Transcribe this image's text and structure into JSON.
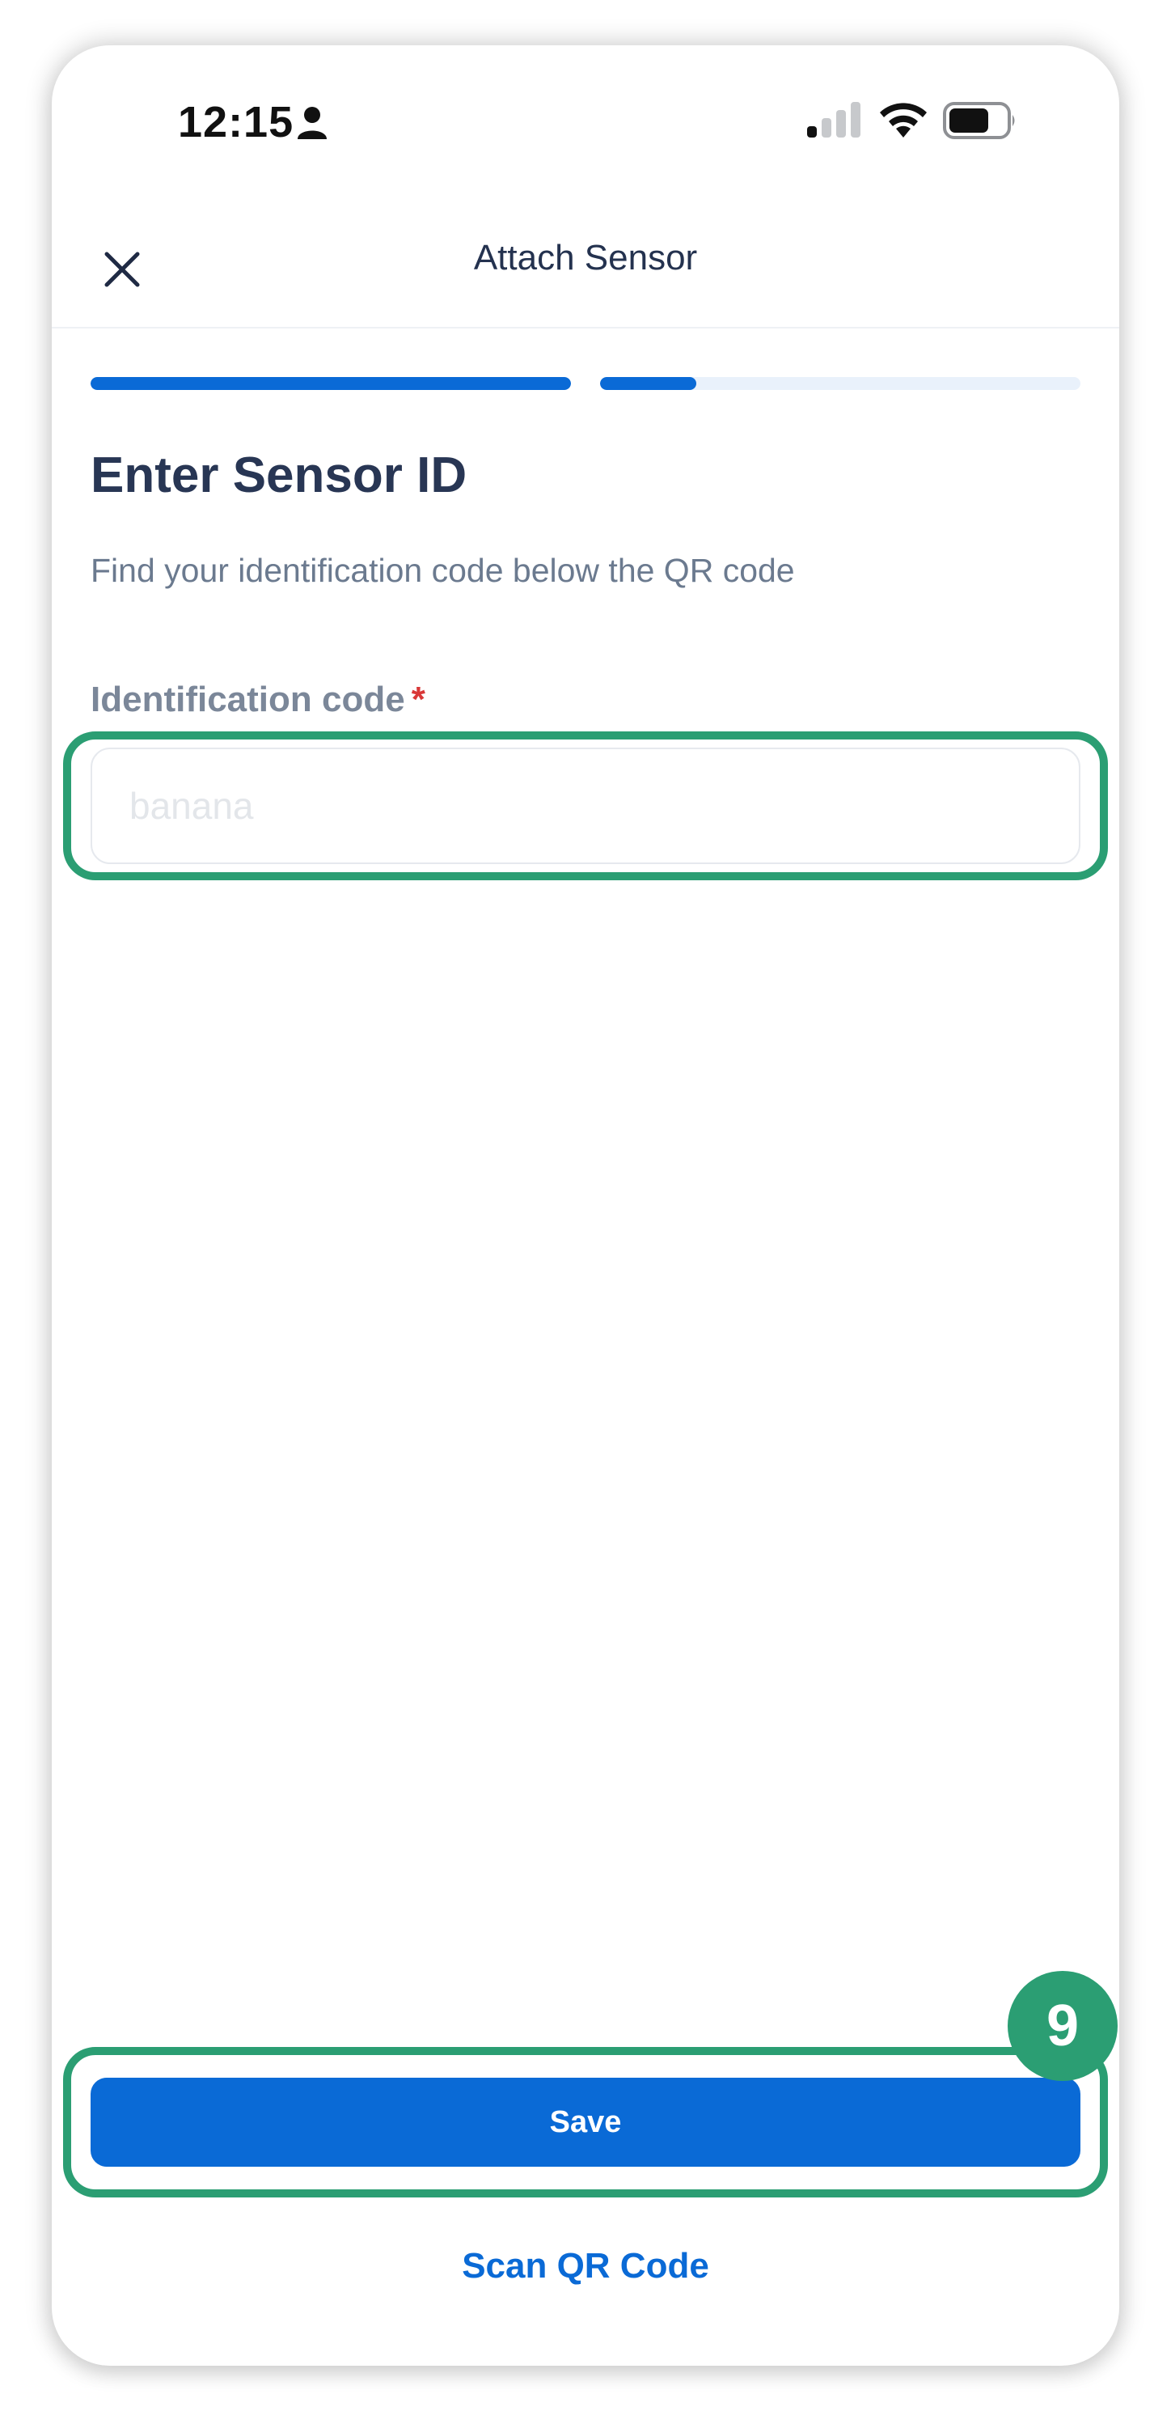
{
  "status_bar": {
    "time": "12:15",
    "icons": [
      "person-icon",
      "cellular-signal-icon",
      "wifi-icon",
      "battery-icon"
    ]
  },
  "header": {
    "title": "Attach Sensor",
    "close_icon": "close-icon"
  },
  "progress": {
    "steps": [
      {
        "fill_fraction": 1.0
      },
      {
        "fill_fraction": 0.2
      }
    ],
    "color_active": "#0a6ad6",
    "color_track": "#e9f1fb"
  },
  "content": {
    "title": "Enter Sensor ID",
    "subtitle": "Find your identification code below the QR code",
    "field": {
      "label": "Identification code",
      "required_marker": "*",
      "placeholder": "banana",
      "value": ""
    }
  },
  "actions": {
    "save_label": "Save",
    "scan_label": "Scan QR Code"
  },
  "annotation": {
    "step_number": "9",
    "highlight_color": "#2b9e73"
  }
}
